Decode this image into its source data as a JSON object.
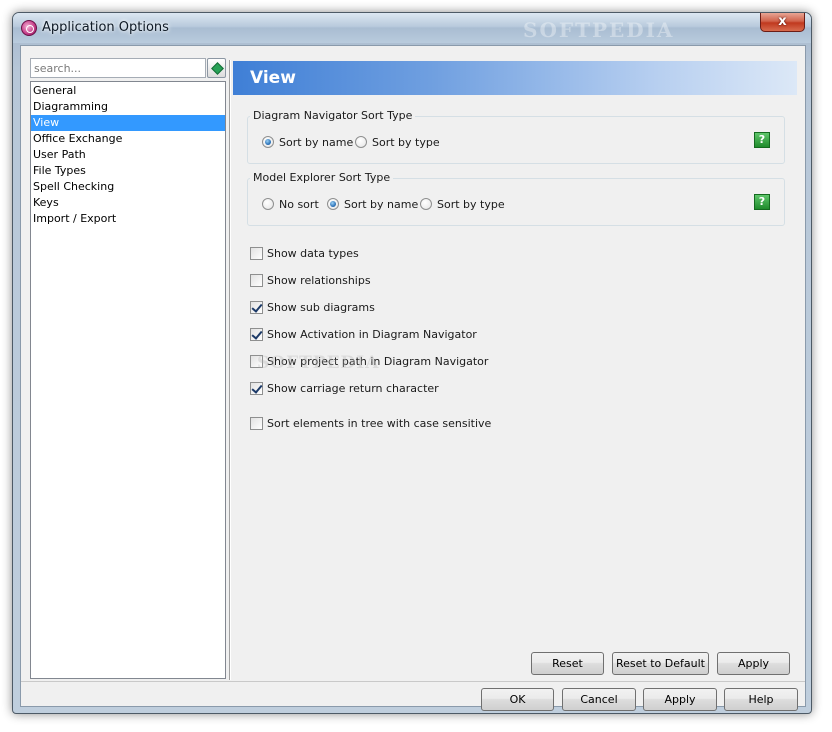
{
  "window": {
    "title": "Application Options",
    "watermark": "SOFTPEDIA",
    "close_label": "x"
  },
  "sidebar": {
    "search_placeholder": "search...",
    "items": [
      {
        "label": "General",
        "selected": false
      },
      {
        "label": "Diagramming",
        "selected": false
      },
      {
        "label": "View",
        "selected": true
      },
      {
        "label": "Office Exchange",
        "selected": false
      },
      {
        "label": "User Path",
        "selected": false
      },
      {
        "label": "File Types",
        "selected": false
      },
      {
        "label": "Spell Checking",
        "selected": false
      },
      {
        "label": "Keys",
        "selected": false
      },
      {
        "label": "Import / Export",
        "selected": false
      }
    ]
  },
  "panel": {
    "title": "View",
    "diagram_navigator": {
      "title": "Diagram Navigator Sort Type",
      "options": [
        {
          "label": "Sort by name",
          "selected": true
        },
        {
          "label": "Sort by type",
          "selected": false
        }
      ],
      "help": "?"
    },
    "model_explorer": {
      "title": "Model Explorer Sort Type",
      "options": [
        {
          "label": "No sort",
          "selected": false
        },
        {
          "label": "Sort by name",
          "selected": true
        },
        {
          "label": "Sort by type",
          "selected": false
        }
      ],
      "help": "?"
    },
    "checkboxes": [
      {
        "label": "Show data types",
        "checked": false
      },
      {
        "label": "Show relationships",
        "checked": false
      },
      {
        "label": "Show sub diagrams",
        "checked": true
      },
      {
        "label": "Show Activation in Diagram Navigator",
        "checked": true
      },
      {
        "label": "Show project path in Diagram Navigator",
        "checked": false
      },
      {
        "label": "Show carriage return character",
        "checked": true
      },
      {
        "label": "Sort elements in tree with case sensitive",
        "checked": false
      }
    ],
    "watermark": "SOFTPEDIA",
    "buttons": {
      "reset": "Reset",
      "reset_default": "Reset to Default",
      "apply": "Apply"
    }
  },
  "footer": {
    "ok": "OK",
    "cancel": "Cancel",
    "apply": "Apply",
    "help": "Help"
  }
}
